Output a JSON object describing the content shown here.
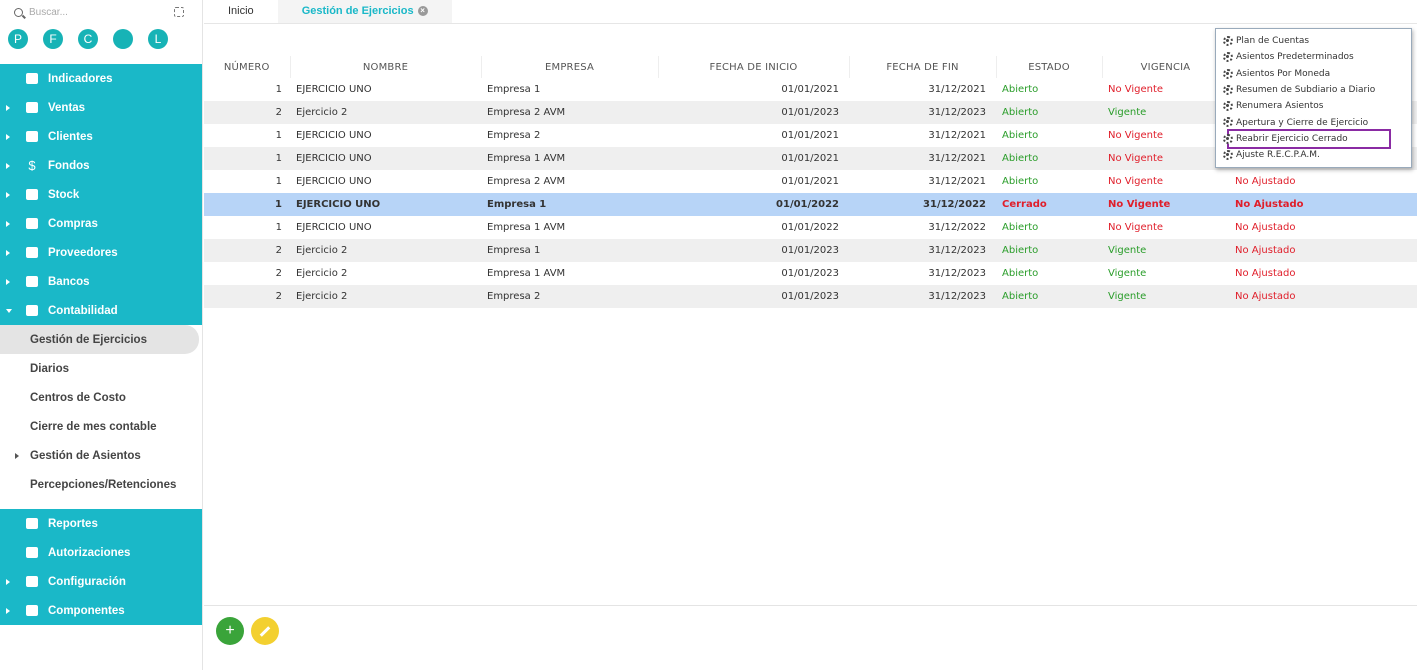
{
  "search": {
    "placeholder": "Buscar..."
  },
  "avatars": [
    "P",
    "F",
    "C",
    "",
    "L"
  ],
  "nav": [
    {
      "label": "Indicadores",
      "icon": "grid-icon",
      "caret": ""
    },
    {
      "label": "Ventas",
      "icon": "cart-icon",
      "caret": "right"
    },
    {
      "label": "Clientes",
      "icon": "users-icon",
      "caret": "right"
    },
    {
      "label": "Fondos",
      "icon": "dollar-icon",
      "caret": "right"
    },
    {
      "label": "Stock",
      "icon": "box-icon",
      "caret": "right"
    },
    {
      "label": "Compras",
      "icon": "cart-icon",
      "caret": "right"
    },
    {
      "label": "Proveedores",
      "icon": "users-icon",
      "caret": "right"
    },
    {
      "label": "Bancos",
      "icon": "briefcase-icon",
      "caret": "right"
    },
    {
      "label": "Contabilidad",
      "icon": "book-icon",
      "caret": "down"
    }
  ],
  "subnav": [
    {
      "label": "Gestión de Ejercicios",
      "active": true
    },
    {
      "label": "Diarios"
    },
    {
      "label": "Centros de Costo"
    },
    {
      "label": "Cierre de mes contable"
    },
    {
      "label": "Gestión de Asientos",
      "caret": true
    },
    {
      "label": "Percepciones/Retenciones"
    }
  ],
  "nav_bottom": [
    {
      "label": "Reportes",
      "icon": "report-icon",
      "caret": ""
    },
    {
      "label": "Autorizaciones",
      "icon": "lock-icon",
      "caret": ""
    },
    {
      "label": "Configuración",
      "icon": "gears-icon",
      "caret": "right"
    },
    {
      "label": "Componentes",
      "icon": "tag-icon",
      "caret": "right"
    }
  ],
  "tabs": [
    {
      "label": "Inicio"
    },
    {
      "label": "Gestión de Ejercicios",
      "active": true
    }
  ],
  "table": {
    "headers": [
      "NÚMERO",
      "NOMBRE",
      "EMPRESA",
      "FECHA DE INICIO",
      "FECHA DE FIN",
      "ESTADO",
      "VIGENCIA",
      ""
    ],
    "rows": [
      [
        "1",
        "EJERCICIO UNO",
        "Empresa 1",
        "01/01/2021",
        "31/12/2021",
        "Abierto",
        "No Vigente",
        ""
      ],
      [
        "2",
        "Ejercicio 2",
        "Empresa 2 AVM",
        "01/01/2023",
        "31/12/2023",
        "Abierto",
        "Vigente",
        ""
      ],
      [
        "1",
        "EJERCICIO UNO",
        "Empresa 2",
        "01/01/2021",
        "31/12/2021",
        "Abierto",
        "No Vigente",
        ""
      ],
      [
        "1",
        "EJERCICIO UNO",
        "Empresa 1 AVM",
        "01/01/2021",
        "31/12/2021",
        "Abierto",
        "No Vigente",
        ""
      ],
      [
        "1",
        "EJERCICIO UNO",
        "Empresa 2 AVM",
        "01/01/2021",
        "31/12/2021",
        "Abierto",
        "No Vigente",
        "No Ajustado"
      ],
      [
        "1",
        "EJERCICIO UNO",
        "Empresa 1",
        "01/01/2022",
        "31/12/2022",
        "Cerrado",
        "No Vigente",
        "No Ajustado"
      ],
      [
        "1",
        "EJERCICIO UNO",
        "Empresa 1 AVM",
        "01/01/2022",
        "31/12/2022",
        "Abierto",
        "No Vigente",
        "No Ajustado"
      ],
      [
        "2",
        "Ejercicio 2",
        "Empresa 1",
        "01/01/2023",
        "31/12/2023",
        "Abierto",
        "Vigente",
        "No Ajustado"
      ],
      [
        "2",
        "Ejercicio 2",
        "Empresa 1 AVM",
        "01/01/2023",
        "31/12/2023",
        "Abierto",
        "Vigente",
        "No Ajustado"
      ],
      [
        "2",
        "Ejercicio 2",
        "Empresa 2",
        "01/01/2023",
        "31/12/2023",
        "Abierto",
        "Vigente",
        "No Ajustado"
      ]
    ],
    "selected_row": 5
  },
  "context_menu": {
    "items": [
      "Plan de Cuentas",
      "Asientos Predeterminados",
      "Asientos Por Moneda",
      "Resumen de Subdiario a Diario",
      "Renumera Asientos",
      "Apertura y Cierre de Ejercicio",
      "Reabrir Ejercicio Cerrado",
      "Ajuste R.E.C.P.A.M."
    ],
    "highlighted": 6
  },
  "footer": {
    "add_label": "+"
  },
  "colors": {
    "accent": "#1ab8c8",
    "selected_row": "#b7d4f7",
    "green": "#2a9d2a",
    "red": "#e01e2a",
    "highlight_border": "#8a2ba3"
  }
}
